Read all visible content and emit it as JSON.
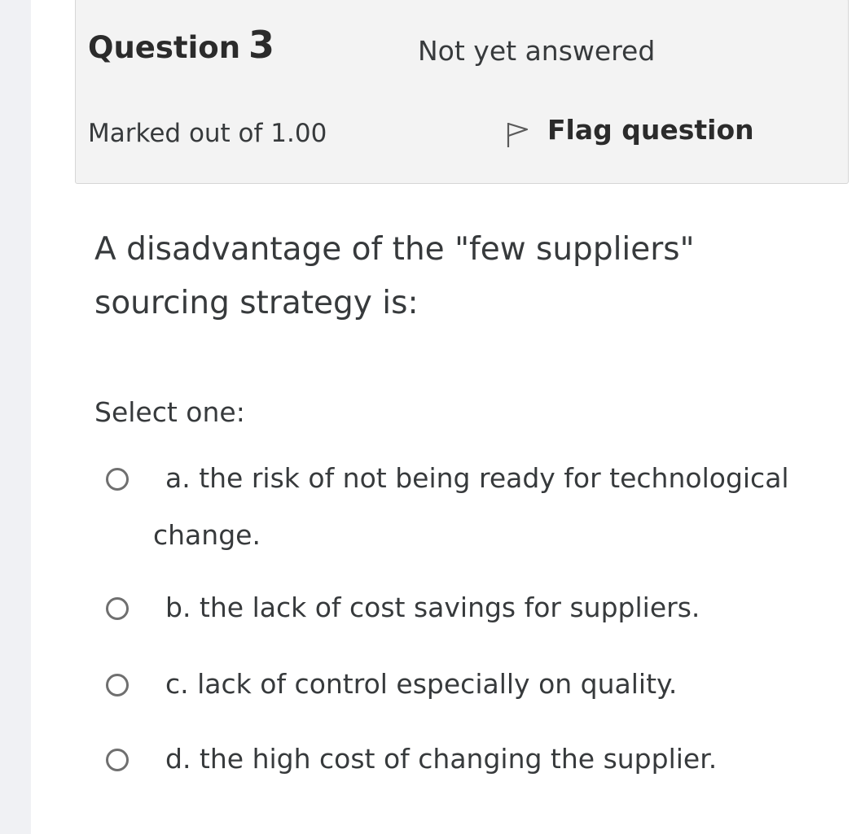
{
  "question": {
    "label": "Question",
    "number": "3",
    "state": "Not yet answered",
    "grade": "Marked out of 1.00",
    "flag_label": "Flag question",
    "flag_icon": "flag-icon",
    "text": "A disadvantage of the \"few suppliers\" sourcing strategy is:",
    "prompt": "Select one:"
  },
  "options": [
    {
      "label": "a. the risk of not being ready for technological change.",
      "selected": false
    },
    {
      "label": "b. the lack of cost savings for suppliers.",
      "selected": false
    },
    {
      "label": "c. lack of control especially on quality.",
      "selected": false
    },
    {
      "label": "d. the high cost of changing the supplier.",
      "selected": false
    }
  ],
  "colors": {
    "info_bg": "#f3f3f3",
    "info_border": "#d6d6d6",
    "text": "#373a3c",
    "radio_border": "#6f6f6f"
  }
}
